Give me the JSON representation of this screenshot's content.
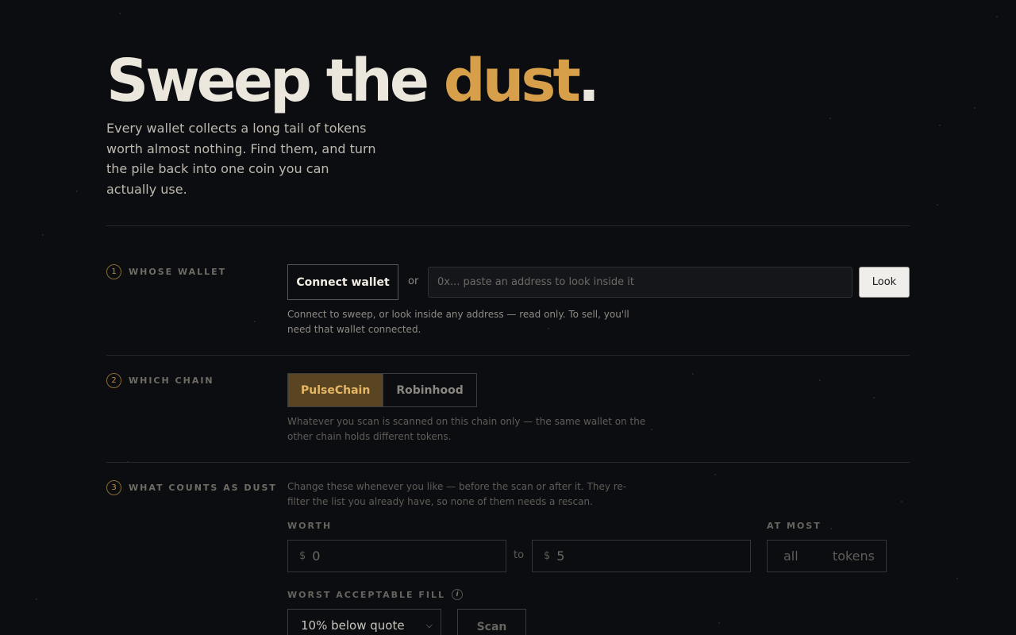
{
  "hero": {
    "title_part1": "Sweep the ",
    "title_accent": "dust",
    "title_end": ".",
    "subtitle": "Every wallet collects a long tail of tokens worth almost nothing. Find them, and turn the pile back into one coin you can actually use."
  },
  "steps": [
    {
      "number": "1",
      "label": "WHOSE WALLET"
    },
    {
      "number": "2",
      "label": "WHICH CHAIN"
    },
    {
      "number": "3",
      "label": "WHAT COUNTS AS DUST"
    }
  ],
  "wallet": {
    "connect_label": "Connect wallet",
    "or_label": "or",
    "address_placeholder": "0x... paste an address to look inside it",
    "look_label": "Look",
    "help": "Connect to sweep, or look inside any address — read only. To sell, you'll need that wallet connected."
  },
  "chain": {
    "options": [
      "PulseChain",
      "Robinhood"
    ],
    "selected": "PulseChain",
    "help": "Whatever you scan is scanned on this chain only — the same wallet on the other chain holds different tokens."
  },
  "dust": {
    "help": "Change these whenever you like — before the scan or after it. They re-filter the list you already have, so none of them needs a rescan.",
    "worth_label": "WORTH",
    "currency_symbol": "$",
    "worth_min": "0",
    "to_label": "to",
    "worth_max": "5",
    "at_most_label": "AT MOST",
    "at_most_value": "all",
    "at_most_unit": "tokens",
    "fill_label": "WORST ACCEPTABLE FILL",
    "fill_selected": "10% below quote",
    "scan_label": "Scan"
  },
  "colors": {
    "background": "#0c0d10",
    "accent": "#d79f4a",
    "active_chain_bg": "#5a4522"
  }
}
